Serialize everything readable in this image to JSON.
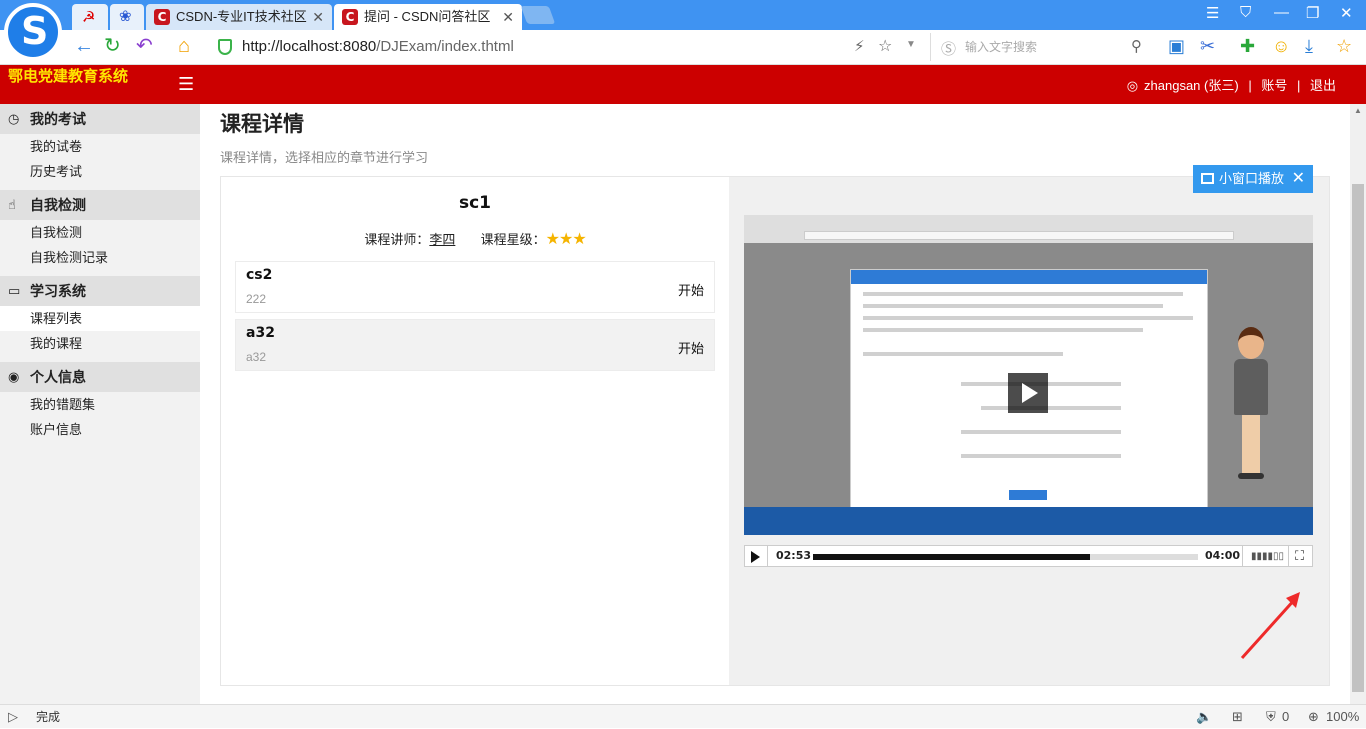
{
  "browser": {
    "tabs": [
      {
        "label": "CSDN-专业IT技术社区"
      },
      {
        "label": "提问 - CSDN问答社区"
      }
    ],
    "url_host": "http://localhost:8080",
    "url_path": "/DJExam/index.thtml",
    "search_placeholder": "输入文字搜索",
    "status": "完成",
    "zoom": "100%",
    "count": "0"
  },
  "header": {
    "title": "鄂电党建教育系统",
    "user": "zhangsan (张三)",
    "account": "账号",
    "logout": "退出",
    "sep": "|"
  },
  "sidebar": {
    "groups": [
      {
        "label": "我的考试",
        "items": [
          "我的试卷",
          "历史考试"
        ]
      },
      {
        "label": "自我检测",
        "items": [
          "自我检测",
          "自我检测记录"
        ]
      },
      {
        "label": "学习系统",
        "items": [
          "课程列表",
          "我的课程"
        ]
      },
      {
        "label": "个人信息",
        "items": [
          "我的错题集",
          "账户信息"
        ]
      }
    ]
  },
  "page": {
    "title": "课程详情",
    "subtitle": "课程详情，选择相应的章节进行学习"
  },
  "course": {
    "name": "sc1",
    "teacher_label": "课程讲师：",
    "teacher": "李四",
    "rating_label": "课程星级：",
    "rating": 3,
    "chapters": [
      {
        "name": "cs2",
        "desc": "222",
        "action": "开始"
      },
      {
        "name": "a32",
        "desc": "a32",
        "action": "开始"
      }
    ]
  },
  "player": {
    "pip_label": "小窗口播放",
    "current_time": "02:53",
    "duration": "04:00",
    "progress": 0.72
  },
  "colors": {
    "header_bg": "#cc0000",
    "title_yellow": "#ffe600",
    "pip_blue": "#3399ee",
    "star": "#f5b400"
  }
}
